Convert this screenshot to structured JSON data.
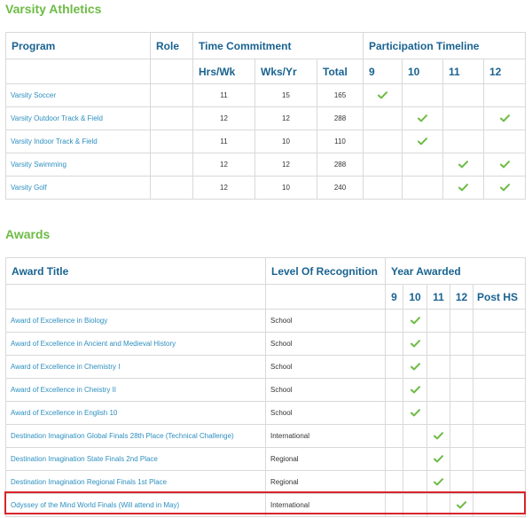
{
  "athletics": {
    "title": "Varsity Athletics",
    "headers": {
      "program": "Program",
      "role": "Role",
      "time_commitment": "Time Commitment",
      "participation_timeline": "Participation Timeline",
      "hrs_wk": "Hrs/Wk",
      "wks_yr": "Wks/Yr",
      "total": "Total",
      "g9": "9",
      "g10": "10",
      "g11": "11",
      "g12": "12"
    },
    "rows": [
      {
        "program": "Varsity Soccer",
        "role": "",
        "hrs": "11",
        "wks": "15",
        "total": "165",
        "grades": [
          true,
          false,
          false,
          false
        ]
      },
      {
        "program": "Varsity Outdoor Track & Field",
        "role": "",
        "hrs": "12",
        "wks": "12",
        "total": "288",
        "grades": [
          false,
          true,
          false,
          true
        ]
      },
      {
        "program": "Varsity Indoor Track & Field",
        "role": "",
        "hrs": "11",
        "wks": "10",
        "total": "110",
        "grades": [
          false,
          true,
          false,
          false
        ]
      },
      {
        "program": "Varsity Swimming",
        "role": "",
        "hrs": "12",
        "wks": "12",
        "total": "288",
        "grades": [
          false,
          false,
          true,
          true
        ]
      },
      {
        "program": "Varsity Golf",
        "role": "",
        "hrs": "12",
        "wks": "10",
        "total": "240",
        "grades": [
          false,
          false,
          true,
          true
        ]
      }
    ]
  },
  "awards": {
    "title": "Awards",
    "headers": {
      "award_title": "Award Title",
      "level": "Level Of Recognition",
      "year_awarded": "Year Awarded",
      "g9": "9",
      "g10": "10",
      "g11": "11",
      "g12": "12",
      "post_hs": "Post HS"
    },
    "rows": [
      {
        "title": "Award of Excellence in Biology",
        "level": "School",
        "years": [
          false,
          true,
          false,
          false,
          false
        ]
      },
      {
        "title": "Award of Excellence in Ancient and Medieval History",
        "level": "School",
        "years": [
          false,
          true,
          false,
          false,
          false
        ]
      },
      {
        "title": "Award of Excellence in Chemistry I",
        "level": "School",
        "years": [
          false,
          true,
          false,
          false,
          false
        ]
      },
      {
        "title": "Award of Excellence in Cheistry II",
        "level": "School",
        "years": [
          false,
          true,
          false,
          false,
          false
        ]
      },
      {
        "title": "Award of Excellence in English 10",
        "level": "School",
        "years": [
          false,
          true,
          false,
          false,
          false
        ]
      },
      {
        "title": "Destination Imagination Global Finals 28th Place (Technical Challenge)",
        "level": "International",
        "years": [
          false,
          false,
          true,
          false,
          false
        ]
      },
      {
        "title": "Destination Imagination State Finals 2nd Place",
        "level": "Regional",
        "years": [
          false,
          false,
          true,
          false,
          false
        ]
      },
      {
        "title": "Destination Imagination Regional Finals 1st Place",
        "level": "Regional",
        "years": [
          false,
          false,
          true,
          false,
          false
        ]
      },
      {
        "title": "Odyssey of the Mind World Finals (Will attend in May)",
        "level": "International",
        "years": [
          false,
          false,
          false,
          true,
          false
        ]
      }
    ]
  },
  "colors": {
    "section_title": "#6dbb45",
    "header_text": "#1a6391",
    "link_text": "#2d8fbf",
    "check": "#6dbb45",
    "highlight": "#d8242b"
  },
  "icons": {
    "check": "checkmark-icon"
  }
}
